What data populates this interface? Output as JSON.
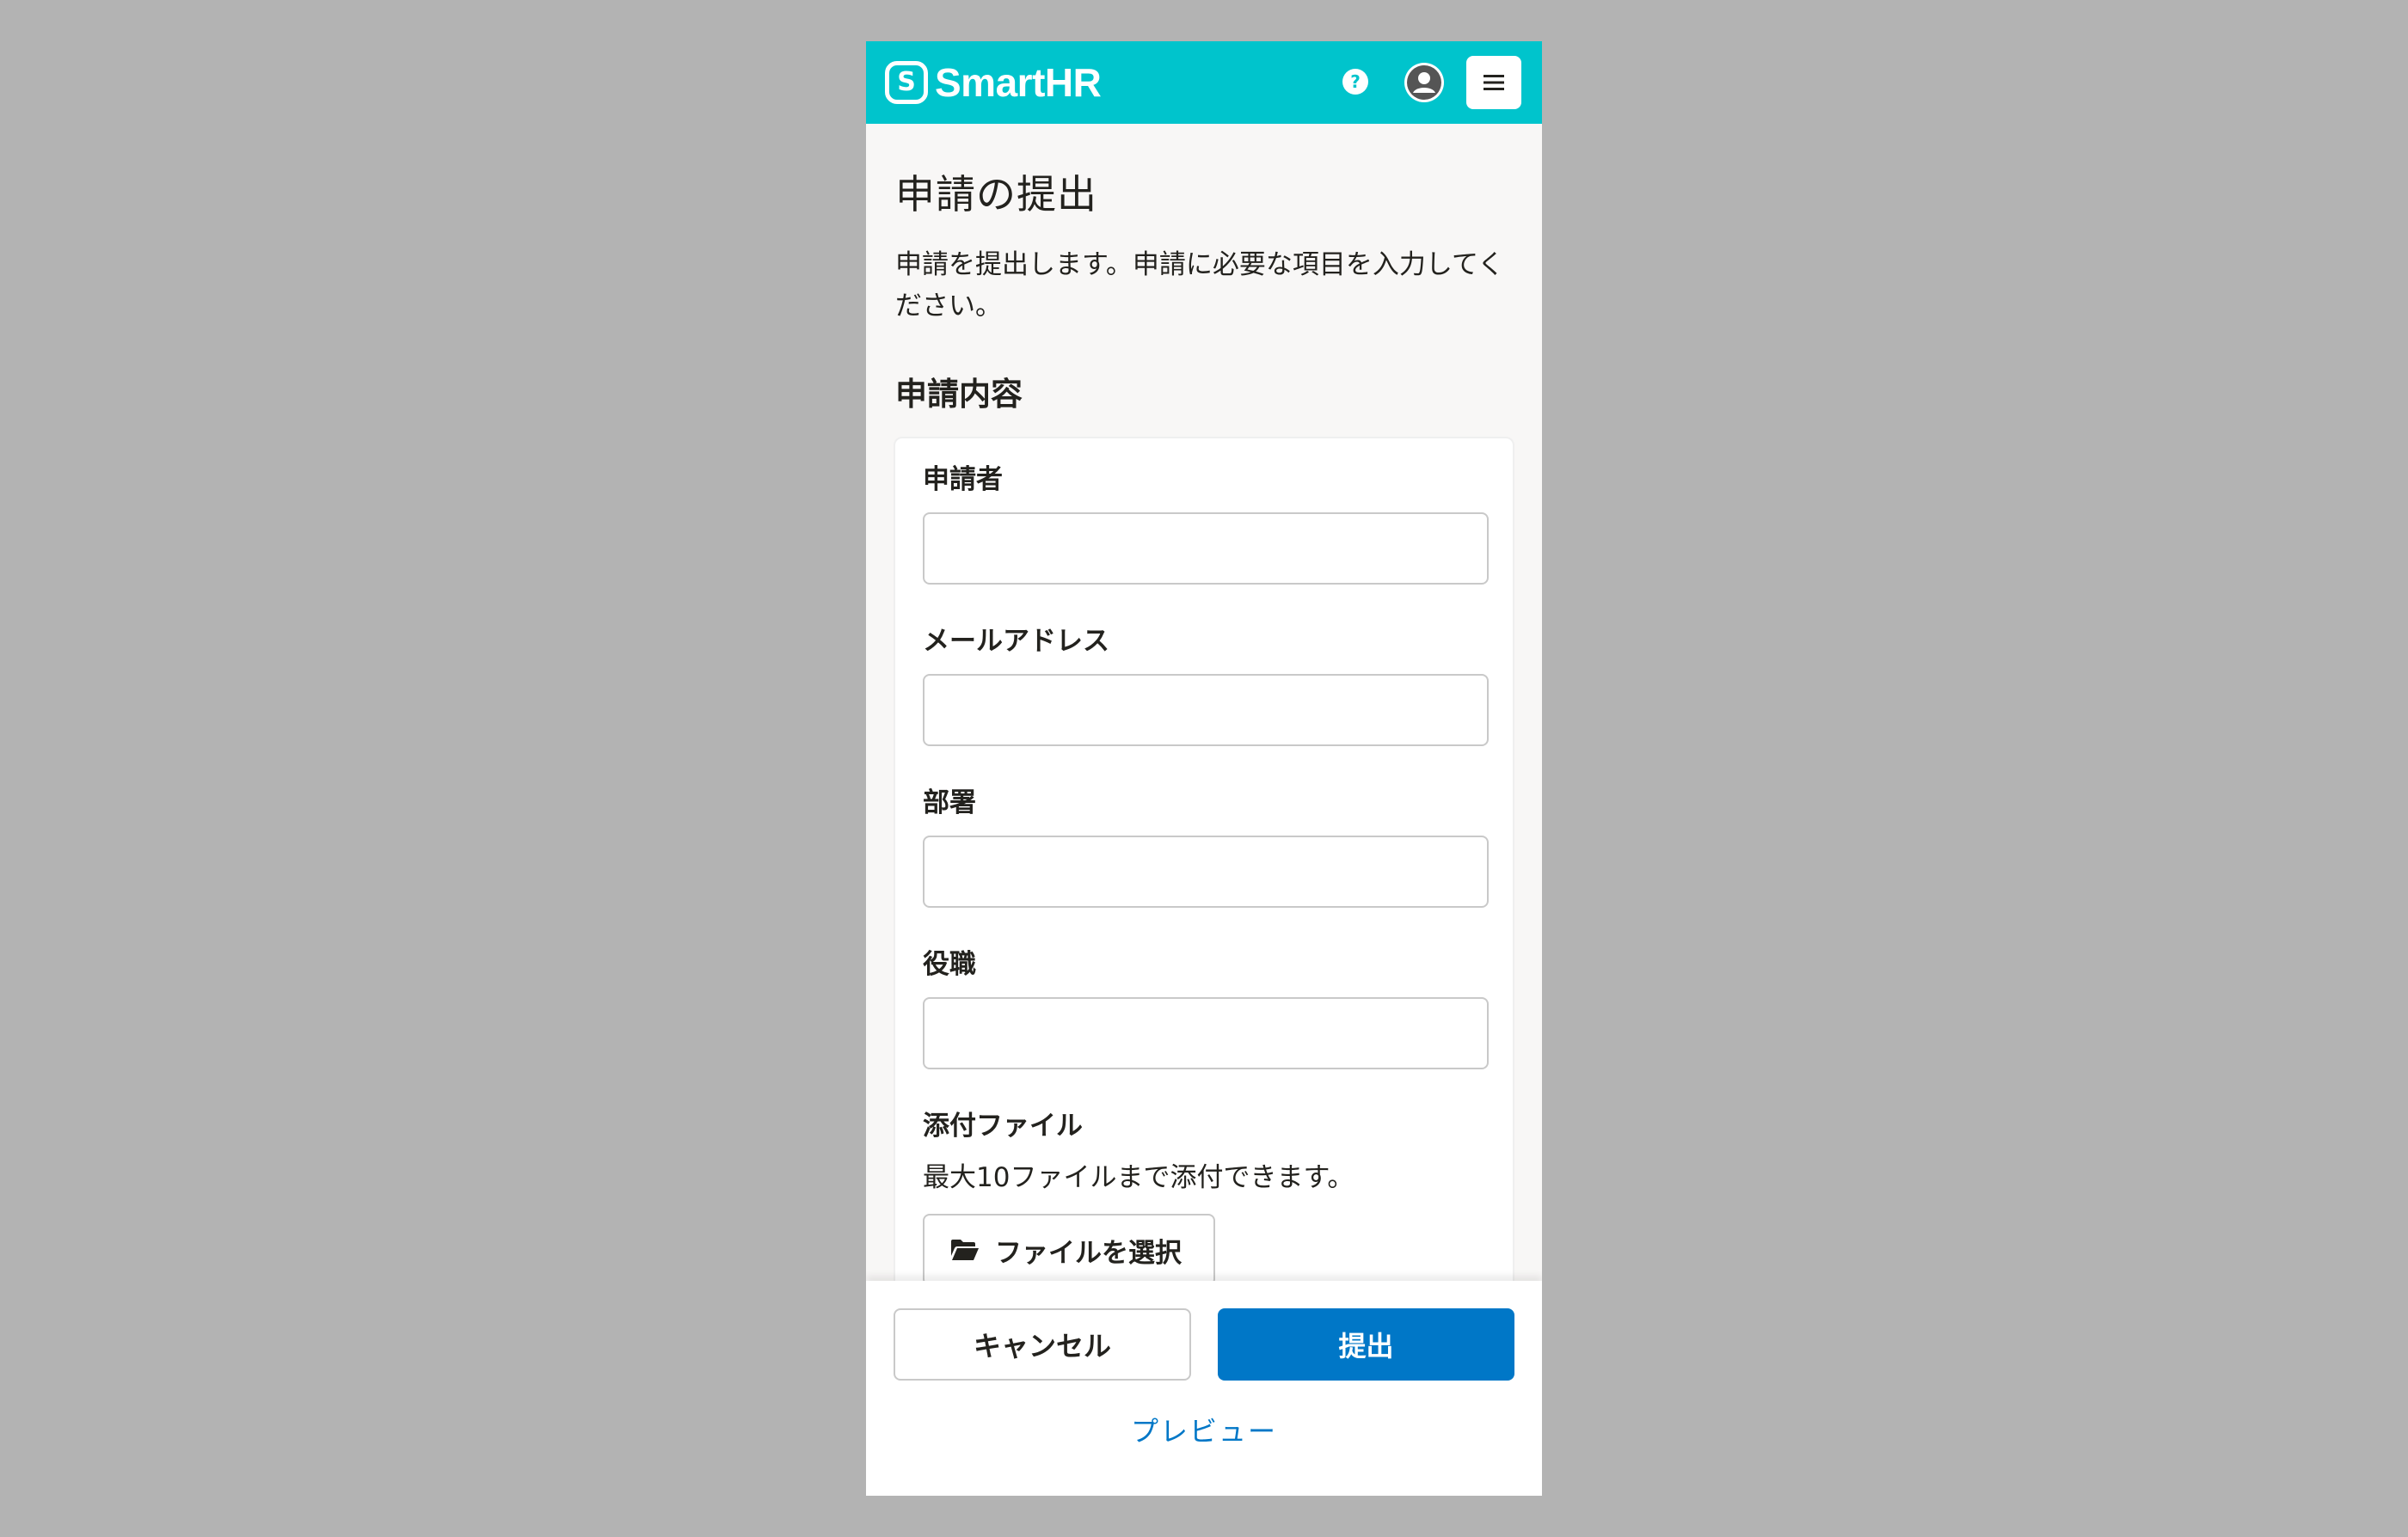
{
  "header": {
    "logo_mark": "S",
    "logo_text": "SmartHR",
    "help_symbol": "?",
    "icons": [
      "help-icon",
      "user-icon",
      "menu-icon"
    ],
    "accent_color": "#00c4cc"
  },
  "page": {
    "title": "申請の提出",
    "description": "申請を提出します。申請に必要な項目を入力してください。",
    "section_title": "申請内容"
  },
  "form": {
    "applicant_label": "申請者",
    "applicant_value": "",
    "email_label": "メールアドレス",
    "email_value": "",
    "department_label": "部署",
    "department_value": "",
    "position_label": "役職",
    "position_value": "",
    "attachment_label": "添付ファイル",
    "attachment_hint": "最大10ファイルまで添付できます。",
    "file_button_label": "ファイルを選択"
  },
  "footer": {
    "cancel_label": "キャンセル",
    "submit_label": "提出",
    "preview_label": "プレビュー",
    "primary_color": "#0077c7"
  }
}
